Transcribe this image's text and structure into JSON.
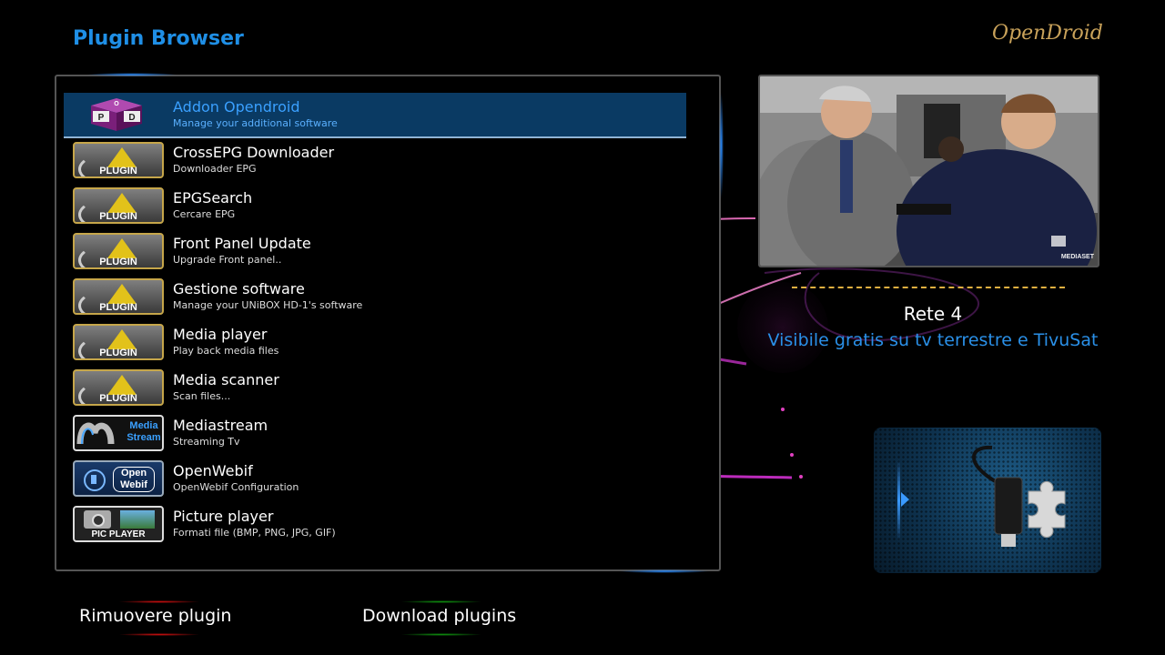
{
  "header": {
    "title": "Plugin Browser",
    "brand": "OpenDroid"
  },
  "plugins": [
    {
      "name": "Addon Opendroid",
      "description": "Manage your additional software",
      "icon": "addon-icon",
      "selected": true
    },
    {
      "name": "CrossEPG Downloader",
      "description": "Downloader EPG",
      "icon": "plugin-icon",
      "icon_label": "PLUGIN"
    },
    {
      "name": "EPGSearch",
      "description": "Cercare EPG",
      "icon": "plugin-icon",
      "icon_label": "PLUGIN"
    },
    {
      "name": "Front Panel Update",
      "description": "Upgrade Front panel..",
      "icon": "plugin-icon",
      "icon_label": "PLUGIN"
    },
    {
      "name": "Gestione software",
      "description": "Manage your UNiBOX HD-1's software",
      "icon": "plugin-icon",
      "icon_label": "PLUGIN"
    },
    {
      "name": "Media player",
      "description": "Play back media files",
      "icon": "plugin-icon",
      "icon_label": "PLUGIN"
    },
    {
      "name": "Media scanner",
      "description": "Scan files...",
      "icon": "plugin-icon",
      "icon_label": "PLUGIN"
    },
    {
      "name": "Mediastream",
      "description": "Streaming Tv",
      "icon": "mediastream-icon",
      "icon_label": "Media Stream"
    },
    {
      "name": "OpenWebif",
      "description": "OpenWebif Configuration",
      "icon": "openwebif-icon",
      "icon_label": "Open Webif"
    },
    {
      "name": "Picture player",
      "description": "Formati file (BMP, PNG, JPG, GIF)",
      "icon": "picture-player-icon",
      "icon_label": "PIC PLAYER"
    }
  ],
  "preview": {
    "channel_name": "Rete 4",
    "channel_description": "Visibile gratis su tv terrestre e TivuSat",
    "watermark": "MEDIASET"
  },
  "buttons": {
    "red_label": "Rimuovere plugin",
    "green_label": "Download plugins"
  },
  "colors": {
    "title": "#1f8fe6",
    "selection_bg": "#0a3a63",
    "red_key": "#d01010",
    "green_key": "#109010",
    "accent_gold": "#e0b040"
  }
}
